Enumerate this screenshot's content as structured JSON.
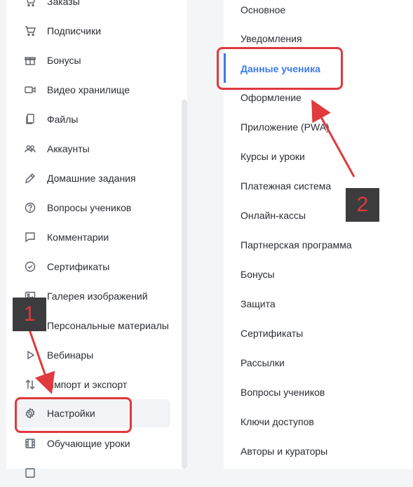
{
  "sidebar": {
    "items": [
      {
        "label": "Заказы",
        "icon": "cart-icon"
      },
      {
        "label": "Подписчики",
        "icon": "cart-icon"
      },
      {
        "label": "Бонусы",
        "icon": "gift-icon"
      },
      {
        "label": "Видео хранилище",
        "icon": "video-icon"
      },
      {
        "label": "Файлы",
        "icon": "files-icon"
      },
      {
        "label": "Аккаунты",
        "icon": "users-icon"
      },
      {
        "label": "Домашние задания",
        "icon": "pencil-icon"
      },
      {
        "label": "Вопросы учеников",
        "icon": "question-icon"
      },
      {
        "label": "Комментарии",
        "icon": "comment-icon"
      },
      {
        "label": "Сертификаты",
        "icon": "certificate-icon"
      },
      {
        "label": "Галерея изображений",
        "icon": "image-icon"
      },
      {
        "label": "Персональные материалы",
        "icon": "folder-icon"
      },
      {
        "label": "Вебинары",
        "icon": "play-icon"
      },
      {
        "label": "Импорт и экспорт",
        "icon": "import-export-icon"
      },
      {
        "label": "Настройки",
        "icon": "gear-icon"
      },
      {
        "label": "Обучающие уроки",
        "icon": "film-icon"
      }
    ]
  },
  "settings_menu": {
    "items": [
      "Основное",
      "Уведомления",
      "Данные ученика",
      "Оформление",
      "Приложение (PWA)",
      "Курсы и уроки",
      "Платежная система",
      "Онлайн-кассы",
      "Партнерская программа",
      "Бонусы",
      "Защита",
      "Сертификаты",
      "Рассылки",
      "Вопросы учеников",
      "Ключи доступов",
      "Авторы и кураторы"
    ]
  },
  "annotations": {
    "step1": "1",
    "step2": "2",
    "color": "#e0393e"
  },
  "colors": {
    "accent": "#3c7be8",
    "annotation_red": "#e0393e"
  }
}
